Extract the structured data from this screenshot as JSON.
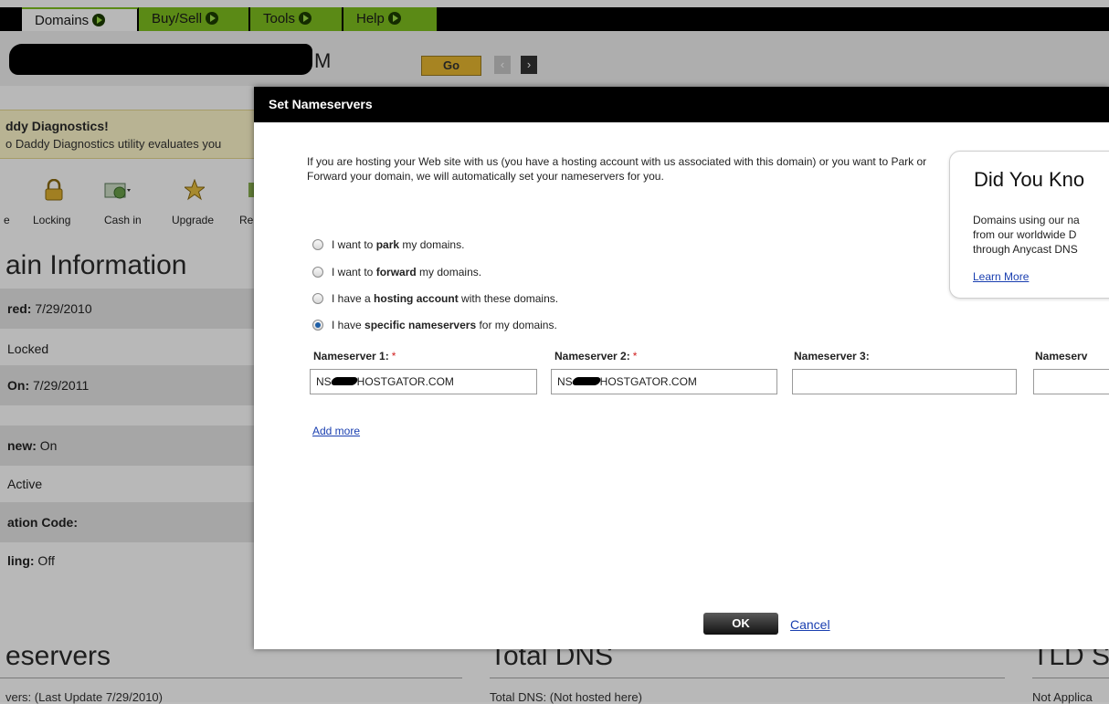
{
  "nav": {
    "tabs": [
      {
        "label": "Domains"
      },
      {
        "label": "Buy/Sell"
      },
      {
        "label": "Tools"
      },
      {
        "label": "Help"
      }
    ]
  },
  "search": {
    "value_visible_suffix": "M",
    "go_label": "Go",
    "prev_label": "‹",
    "next_label": "›"
  },
  "background": {
    "diagnostics_title": "ddy Diagnostics!",
    "diagnostics_text": "o Daddy Diagnostics utility evaluates you",
    "toolbar": [
      "e",
      "Locking",
      "Cash in",
      "Upgrade",
      "Re"
    ],
    "heading": "ain Information",
    "rows": [
      {
        "label": "red:",
        "value": " 7/29/2010"
      },
      {
        "label": "",
        "value": " Locked"
      },
      {
        "label": "On:",
        "value": " 7/29/2011"
      },
      {
        "label": "",
        "value": ""
      },
      {
        "label": "new:",
        "value": " On"
      },
      {
        "label": "",
        "value": "Active"
      },
      {
        "label": "ation Code:",
        "value": ""
      },
      {
        "label": "ling:",
        "value": " Off"
      }
    ],
    "bottom": {
      "col1_heading": "eservers",
      "col1_text": "vers:  (Last Update 7/29/2010)",
      "col2_heading": "Total DNS",
      "col2_text": "Total DNS: (Not hosted here)",
      "col3_heading": "TLD S",
      "col3_text": "Not Applica"
    }
  },
  "modal": {
    "title": "Set Nameservers",
    "intro": "If you are hosting your Web site with us (you have a hosting account with us associated with this domain) or you want to Park or Forward your domain, we will automatically set your nameservers for you.",
    "options": [
      {
        "pre": "I want to ",
        "bold": "park",
        "post": " my domains.",
        "selected": false
      },
      {
        "pre": "I want to ",
        "bold": "forward",
        "post": " my domains.",
        "selected": false
      },
      {
        "pre": "I have a ",
        "bold": "hosting account",
        "post": " with these domains.",
        "selected": false
      },
      {
        "pre": "I have ",
        "bold": "specific nameservers",
        "post": " for my domains.",
        "selected": true
      }
    ],
    "nameservers": [
      {
        "label": "Nameserver 1:",
        "required": "*",
        "prefix": "NS",
        "suffix": "HOSTGATOR.COM"
      },
      {
        "label": "Nameserver 2:",
        "required": "*",
        "prefix": "NS",
        "suffix": "HOSTGATOR.COM"
      },
      {
        "label": "Nameserver 3:",
        "required": "",
        "prefix": "",
        "suffix": ""
      },
      {
        "label": "Nameserv",
        "required": "",
        "prefix": "",
        "suffix": ""
      }
    ],
    "add_more": "Add more",
    "did_you_know": {
      "title": "Did You Kno",
      "lines": [
        "Domains using our na",
        "from our worldwide D",
        "through Anycast DNS"
      ],
      "link": "Learn More"
    },
    "ok_label": "OK",
    "cancel_label": "Cancel"
  }
}
